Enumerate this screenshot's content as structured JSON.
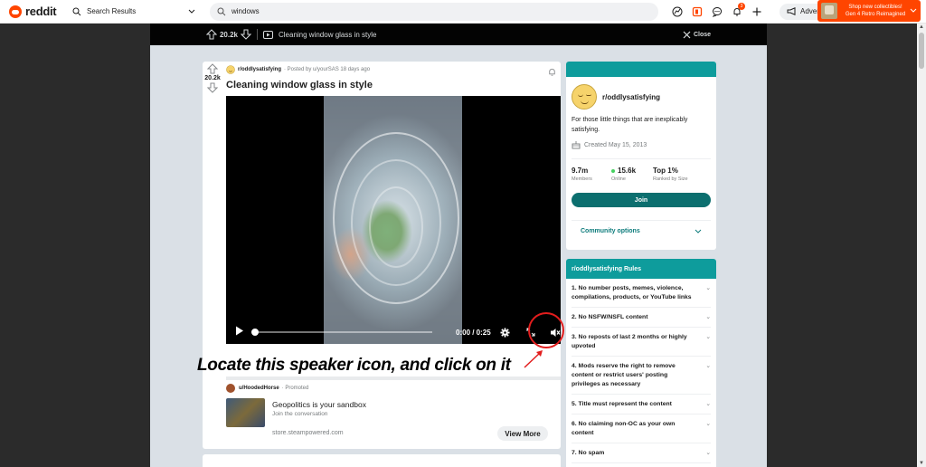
{
  "header": {
    "brand": "reddit",
    "context": "Search Results",
    "search_value": "windows",
    "advertise": "Advertise",
    "notification_count": "3",
    "promo_line1": "Shop new collectibles!",
    "promo_line2": "Gen 4 Retro Reimagined"
  },
  "postbar": {
    "votes": "20.2k",
    "title": "Cleaning window glass in style",
    "close": "Close"
  },
  "post": {
    "votes": "20.2k",
    "subreddit": "r/oddlysatisfying",
    "posted_by": "· Posted by u/yourSAS 18 days ago",
    "title": "Cleaning window glass in style",
    "time": "0:00 / 0:25",
    "progress": 0.0
  },
  "annotation": {
    "text": "Locate this speaker icon, and click on it",
    "color": "#e21d1d"
  },
  "ad": {
    "user": "u/HoodedHorse",
    "promoted": "· Promoted",
    "headline": "Geopolitics is your sandbox",
    "subline": "Join the conversation",
    "domain": "store.steampowered.com",
    "cta": "View More"
  },
  "about": {
    "name": "r/oddlysatisfying",
    "description": "For those little things that are inexplicably satisfying.",
    "created": "Created May 15, 2013",
    "stats": [
      {
        "value": "9.7m",
        "label": "Members"
      },
      {
        "value": "15.6k",
        "label": "Online"
      },
      {
        "value": "Top 1%",
        "label": "Ranked by Size"
      }
    ],
    "join": "Join",
    "community_options": "Community options",
    "accent": "#0e9c9c"
  },
  "rules": {
    "title": "r/oddlysatisfying Rules",
    "items": [
      "1. No number posts, memes, violence, compilations, products, or YouTube links",
      "2. No NSFW/NSFL content",
      "3. No reposts of last 2 months or highly upvoted",
      "4. Mods reserve the right to remove content or restrict users' posting privileges as necessary",
      "5. Title must represent the content",
      "6. No claiming non-OC as your own content",
      "7. No spam"
    ]
  }
}
